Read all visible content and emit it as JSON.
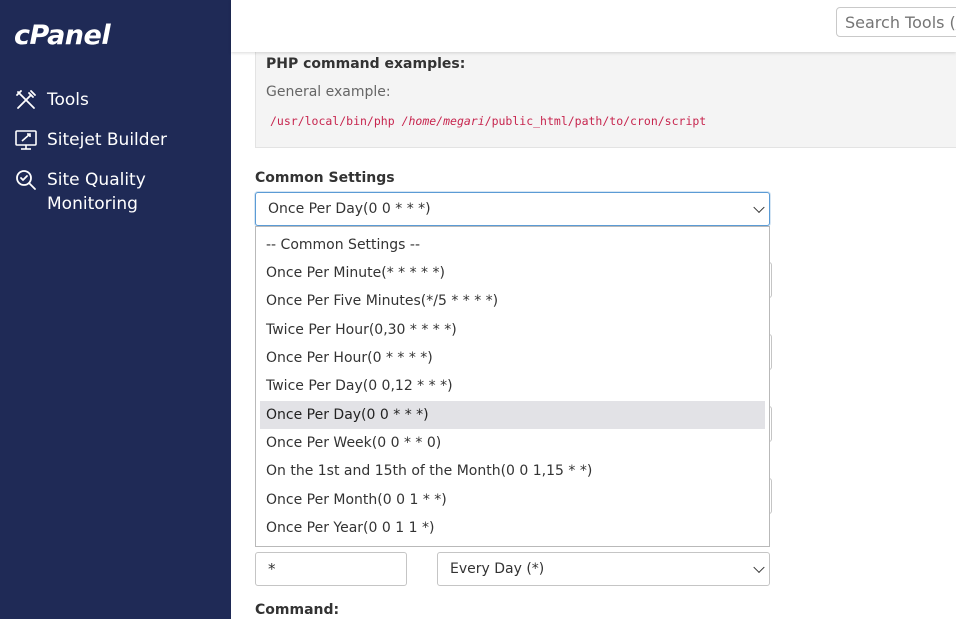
{
  "sidebar": {
    "logo": "cPanel",
    "items": [
      {
        "label": "Tools",
        "icon": "tools-icon"
      },
      {
        "label": "Sitejet Builder",
        "icon": "sitejet-icon"
      },
      {
        "label": "Site Quality Monitoring",
        "icon": "site-quality-icon"
      }
    ]
  },
  "header": {
    "search_placeholder": "Search Tools (/)"
  },
  "examples": {
    "title": "PHP command examples:",
    "general_label": "General example:",
    "code_prefix": "/usr/local/bin/php ",
    "code_home": "/home/megari",
    "code_path": "/public_html/path/to/cron/script"
  },
  "common_settings": {
    "label": "Common Settings",
    "selected": "Once Per Day(0 0 * * *)",
    "options": [
      "-- Common Settings --",
      "Once Per Minute(* * * * *)",
      "Once Per Five Minutes(*/5 * * * *)",
      "Twice Per Hour(0,30 * * * *)",
      "Once Per Hour(0 * * * *)",
      "Twice Per Day(0 0,12 * * *)",
      "Once Per Day(0 0 * * *)",
      "Once Per Week(0 0 * * 0)",
      "On the 1st and 15th of the Month(0 0 1,15 * *)",
      "Once Per Month(0 0 1 * *)",
      "Once Per Year(0 0 1 1 *)"
    ],
    "selected_index": 6
  },
  "weekday": {
    "value": "*",
    "select_label": "Every Day (*)"
  },
  "command": {
    "label": "Command:"
  }
}
